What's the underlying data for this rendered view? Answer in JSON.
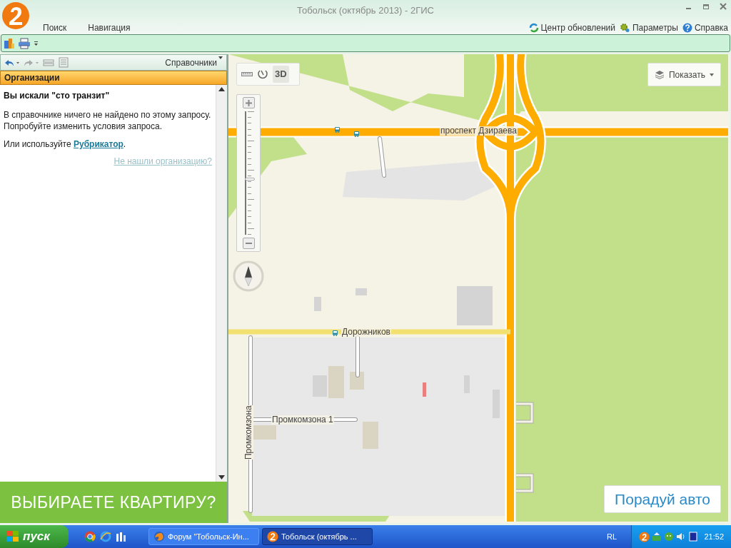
{
  "window": {
    "title": "Тобольск (октябрь 2013) - 2ГИС"
  },
  "menu": [
    {
      "label": "Поиск"
    },
    {
      "label": "Навигация"
    }
  ],
  "header_links": [
    {
      "kind": "update",
      "label": "Центр обновлений"
    },
    {
      "kind": "settings",
      "label": "Параметры"
    },
    {
      "kind": "help",
      "label": "Справка"
    }
  ],
  "panel": {
    "directories": "Справочники",
    "section": "Организации",
    "heading": "Вы искали \"сто транзит\"",
    "message": "В справочнике ничего не найдено по этому запросу. Попробуйте изменить условия запроса.",
    "hint_before": "Или используйте ",
    "hint_link": "Рубрикатор",
    "hint_after": ".",
    "not_found_link": "Не нашли организацию?",
    "banner": "ВЫБИРАЕТЕ КВАРТИРУ?"
  },
  "map": {
    "mode_3d": "3D",
    "zoom": {
      "level": 0.45
    },
    "show_button": "Показать",
    "ad": "Порадуй авто",
    "streets": [
      {
        "kind": "avenue",
        "label": "проспект Дзираева"
      },
      {
        "kind": "street",
        "label": "Дорожников"
      },
      {
        "kind": "vertical",
        "label": "Промкомзона"
      },
      {
        "kind": "lane",
        "label": "Промкомзона 1"
      }
    ]
  },
  "taskbar": {
    "start": "пуск",
    "tasks": [
      {
        "label": "Форум \"Тобольск-Ин...",
        "selected": false,
        "kind": "browser"
      },
      {
        "label": "Тобольск (октябрь ...",
        "selected": true,
        "kind": "app"
      }
    ],
    "language": "RL",
    "clock": "21:52"
  }
}
